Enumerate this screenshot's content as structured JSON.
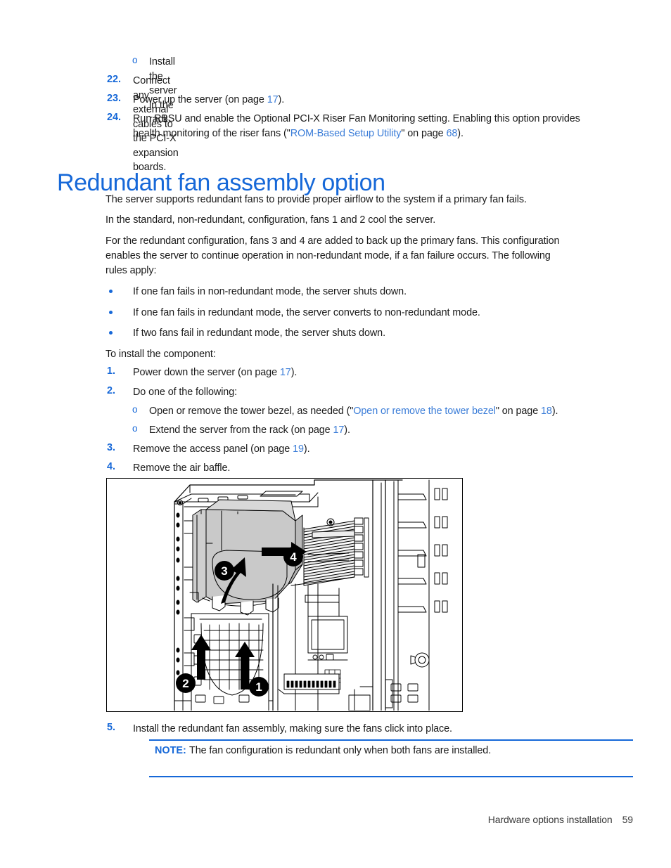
{
  "document": {
    "heading": "Redundant fan assembly option"
  },
  "top_list": {
    "sub_item": {
      "marker": "o",
      "text": "Install the server in the rack."
    },
    "items": [
      {
        "marker": "22.",
        "text": "Connect any external cables to the PCI-X expansion boards."
      },
      {
        "marker": "23.",
        "text_before": "Power up the server (on page ",
        "page_ref": "17",
        "text_after": ")."
      },
      {
        "marker": "24.",
        "line1": "Run RBSU and enable the Optional PCI-X Riser Fan Monitoring setting. Enabling this option provides",
        "line2_before": "health monitoring of the riser fans (\"",
        "link": "ROM-Based Setup Utility",
        "line2_mid": "\" on page ",
        "page_ref": "68",
        "line2_after": ")."
      }
    ]
  },
  "intro": {
    "para1": "The server supports redundant fans to provide proper airflow to the system if a primary fan fails.",
    "para2": "In the standard, non-redundant, configuration, fans 1 and 2 cool the server.",
    "para3_line1": "For the redundant configuration, fans 3 and 4 are added to back up the primary fans. This configuration",
    "para3_line2": "enables the server to continue operation in non-redundant mode, if a fan failure occurs. The following",
    "para3_line3": "rules apply:"
  },
  "rules": [
    "If one fan fails in non-redundant mode, the server shuts down.",
    "If one fan fails in redundant mode, the server converts to non-redundant mode.",
    "If two fans fail in redundant mode, the server shuts down."
  ],
  "install": {
    "lead": "To install the component:",
    "steps": [
      {
        "marker": "1.",
        "text_before": "Power down the server (on page ",
        "page_ref": "17",
        "text_after": ")."
      },
      {
        "marker": "2.",
        "text": "Do one of the following:",
        "sub_items": [
          {
            "marker": "o",
            "text_before": "Open or remove the tower bezel, as needed (\"",
            "link": "Open or remove the tower bezel",
            "text_mid": "\" on page ",
            "page_ref": "18",
            "text_after": ")."
          },
          {
            "marker": "o",
            "text_before": "Extend the server from the rack (on page ",
            "page_ref": "17",
            "text_after": ")."
          }
        ]
      },
      {
        "marker": "3.",
        "text_before": "Remove the access panel (on page ",
        "page_ref": "19",
        "text_after": ")."
      },
      {
        "marker": "4.",
        "text": "Remove the air baffle."
      },
      {
        "marker": "5.",
        "text": "Install the redundant fan assembly, making sure the fans click into place."
      }
    ]
  },
  "figure": {
    "alt": "Line drawing of server chassis showing removal of the air baffle with four numbered callouts",
    "callouts": [
      "1",
      "2",
      "3",
      "4"
    ]
  },
  "note": {
    "label": "NOTE:",
    "text": "The fan configuration is redundant only when both fans are installed."
  },
  "footer": {
    "section": "Hardware options installation",
    "page_number": "59"
  },
  "colors": {
    "heading_blue": "#1668d8",
    "link_blue": "#3b7dd8",
    "text_black": "#1a1a1a"
  }
}
